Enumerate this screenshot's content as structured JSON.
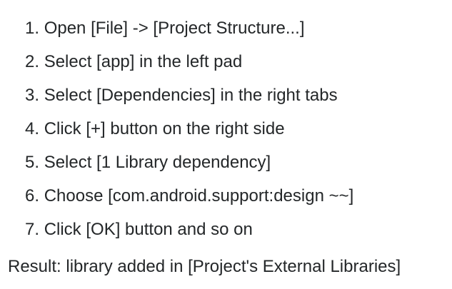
{
  "steps": [
    {
      "number": "1.",
      "text": "Open [File] -> [Project Structure...]"
    },
    {
      "number": "2.",
      "text": "Select [app] in the left pad"
    },
    {
      "number": "3.",
      "text": "Select [Dependencies] in the right tabs"
    },
    {
      "number": "4.",
      "text": "Click [+] button on the right side"
    },
    {
      "number": "5.",
      "text": "Select [1 Library dependency]"
    },
    {
      "number": "6.",
      "text": "Choose [com.android.support:design ~~]"
    },
    {
      "number": "7.",
      "text": "Click [OK] button and so on"
    }
  ],
  "result": "Result: library added in [Project's External Libraries]"
}
